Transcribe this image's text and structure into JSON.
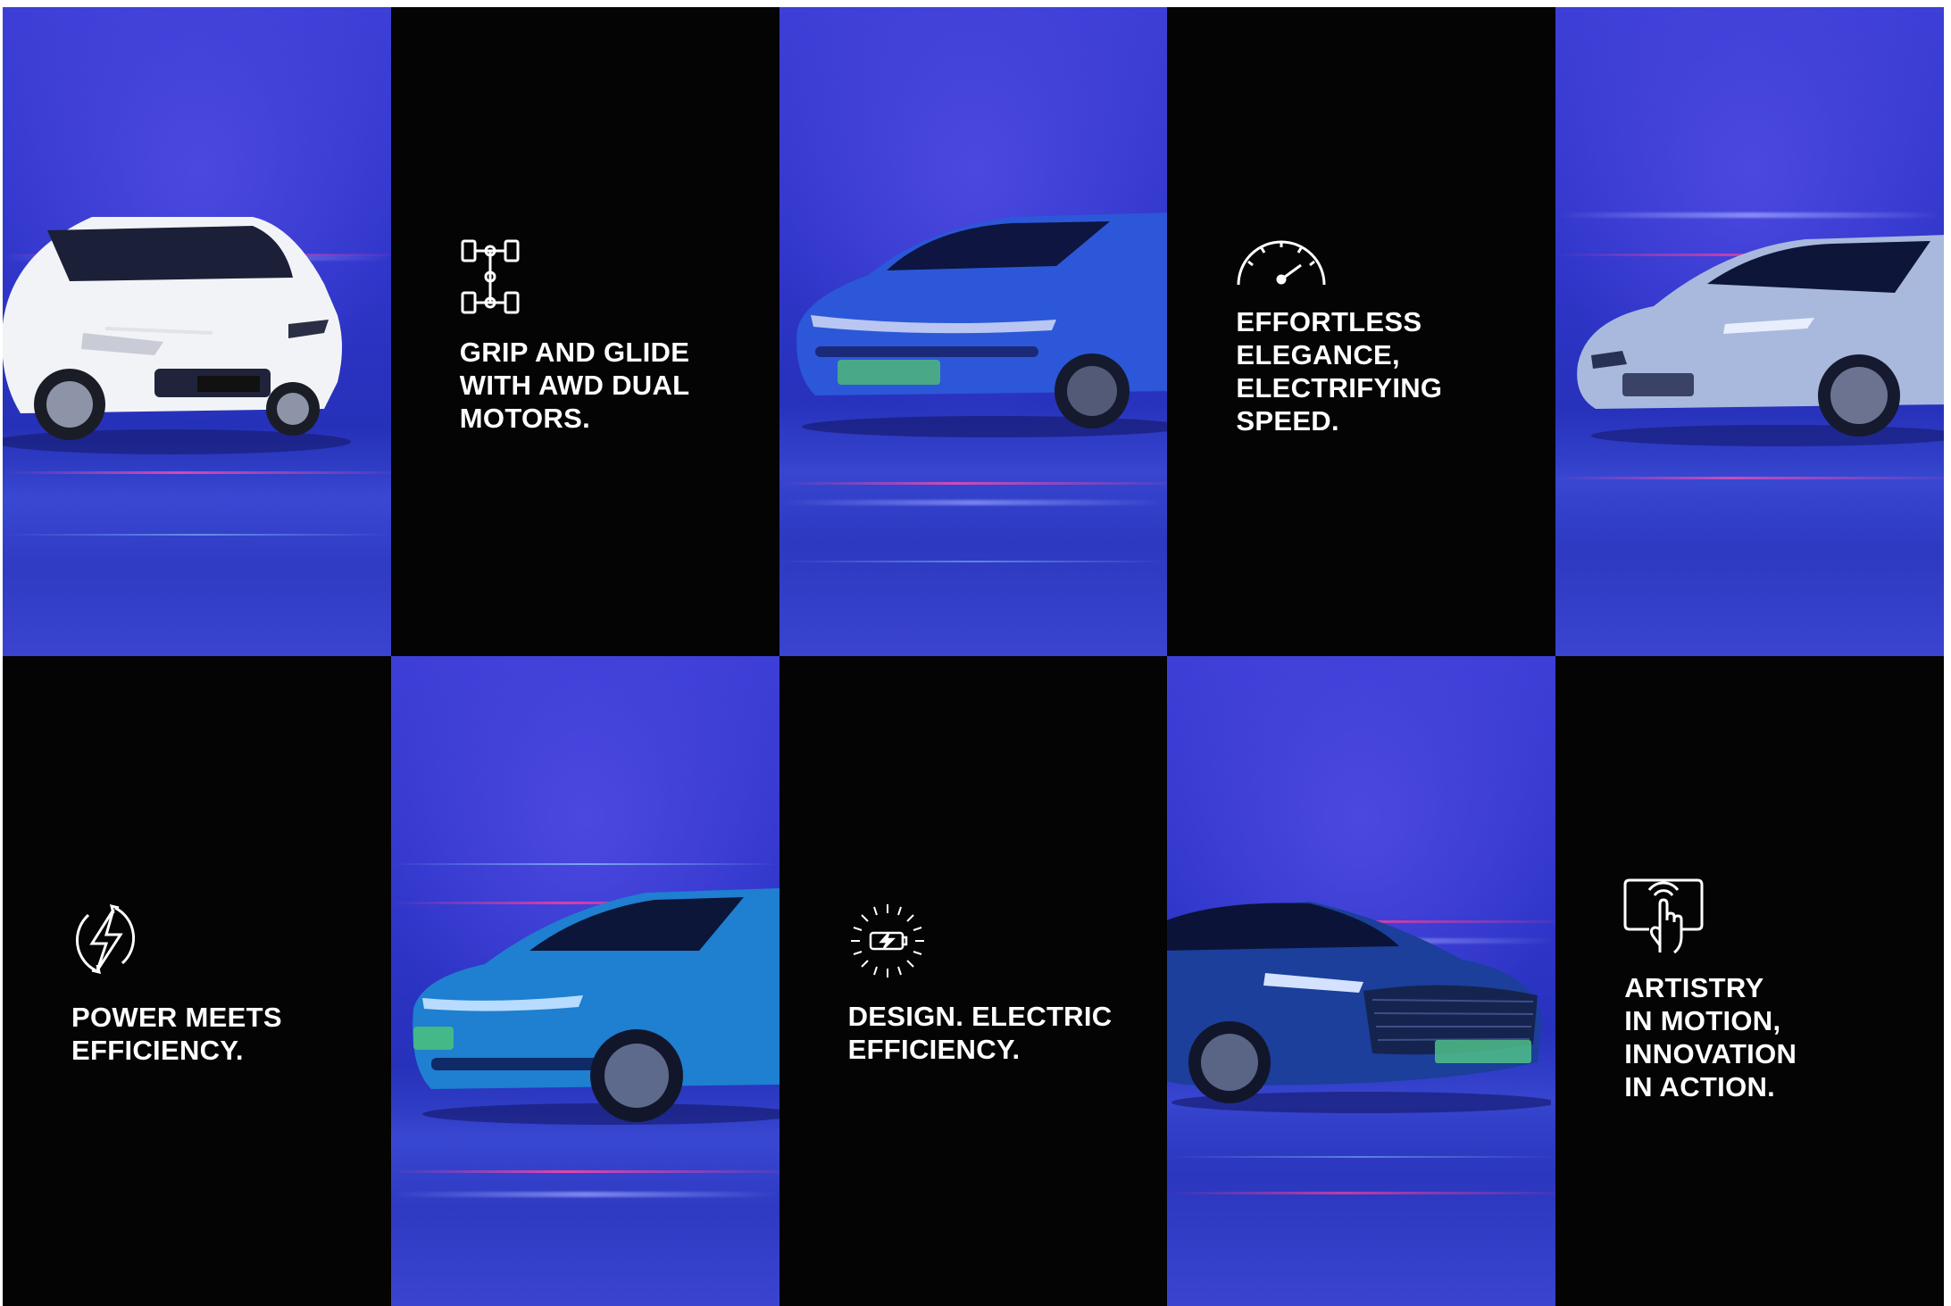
{
  "panels": [
    {
      "kind": "car",
      "icon": "white-suv-image"
    },
    {
      "kind": "text",
      "icon": "awd-drivetrain-icon",
      "lines": [
        "GRIP AND GLIDE",
        "WITH AWD DUAL",
        "MOTORS."
      ]
    },
    {
      "kind": "car",
      "icon": "blue-sedan-image"
    },
    {
      "kind": "text",
      "icon": "speedometer-icon",
      "lines": [
        "EFFORTLESS",
        "ELEGANCE,",
        "ELECTRIFYING",
        "SPEED."
      ]
    },
    {
      "kind": "car",
      "icon": "silver-sports-sedan-image"
    },
    {
      "kind": "text",
      "icon": "lightning-cycle-icon",
      "lines": [
        "POWER MEETS",
        "EFFICIENCY."
      ]
    },
    {
      "kind": "car",
      "icon": "teal-crossover-image"
    },
    {
      "kind": "text",
      "icon": "battery-charging-icon",
      "lines": [
        "DESIGN. ELECTRIC",
        "EFFICIENCY."
      ]
    },
    {
      "kind": "car",
      "icon": "navy-sedan-image"
    },
    {
      "kind": "text",
      "icon": "touchscreen-hand-icon",
      "lines": [
        "ARTISTRY",
        "IN MOTION,",
        "INNOVATION",
        "IN ACTION."
      ]
    }
  ],
  "colors": {
    "backdrop_blue": "#3238cc",
    "panel_black": "#040404",
    "caption_text": "#ffffff",
    "streak_pink": "#ff3d9a"
  }
}
